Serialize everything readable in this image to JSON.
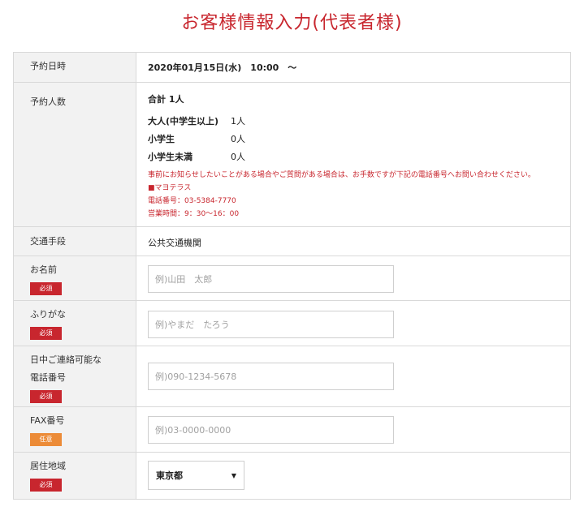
{
  "title": "お客様情報入力(代表者様)",
  "reservation_datetime": {
    "label": "予約日時",
    "value": "2020年01月15日(水)　10:00　～"
  },
  "party_size": {
    "label": "予約人数",
    "total": "合計 1人",
    "breakdown": [
      {
        "label": "大人(中学生以上)",
        "value": "1人"
      },
      {
        "label": "小学生",
        "value": "0人"
      },
      {
        "label": "小学生未満",
        "value": "0人"
      }
    ],
    "notice": {
      "message": "事前にお知らせしたいことがある場合やご質問がある場合は、お手数ですが下記の電話番号へお問い合わせください。",
      "venue": "■マヨテラス",
      "phone": "電話番号：03-5384-7770",
      "hours": "営業時間：9：30～16：00"
    }
  },
  "transport": {
    "label": "交通手段",
    "value": "公共交通機関"
  },
  "name": {
    "label": "お名前",
    "badge": "必須",
    "placeholder": "例)山田　太郎",
    "value": ""
  },
  "furigana": {
    "label": "ふりがな",
    "badge": "必須",
    "placeholder": "例)やまだ　たろう",
    "value": ""
  },
  "daytime_phone": {
    "label_line1": "日中ご連絡可能な",
    "label_line2": "電話番号",
    "badge": "必須",
    "placeholder": "例)090-1234-5678",
    "value": ""
  },
  "fax": {
    "label": "FAX番号",
    "badge": "任意",
    "placeholder": "例)03-0000-0000",
    "value": ""
  },
  "residence": {
    "label": "居住地域",
    "badge": "必須",
    "selected": "東京都"
  },
  "colors": {
    "accent": "#c8262e",
    "optional_badge": "#ec8b37",
    "header_bg": "#f2f2f2"
  }
}
